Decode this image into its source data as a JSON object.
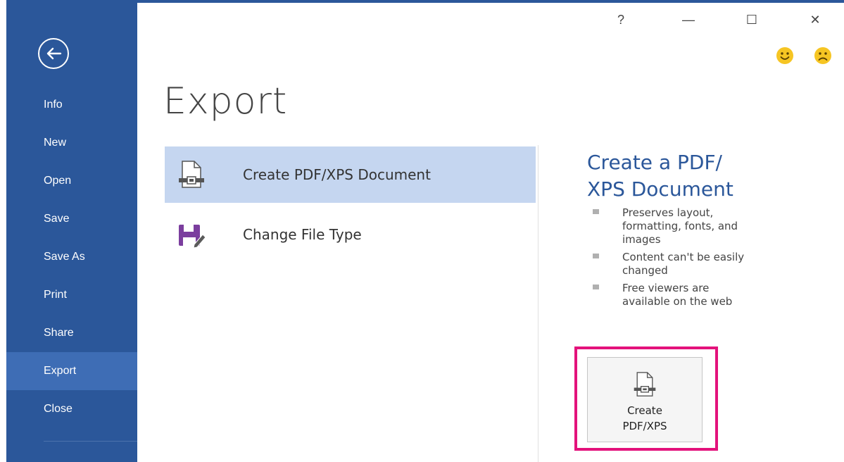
{
  "window_controls": {
    "help": "?",
    "minimize": "—",
    "maximize": "☐",
    "close": "✕"
  },
  "sidebar": {
    "back_icon": "back-arrow-icon",
    "items": [
      {
        "label": "Info",
        "active": false
      },
      {
        "label": "New",
        "active": false
      },
      {
        "label": "Open",
        "active": false
      },
      {
        "label": "Save",
        "active": false
      },
      {
        "label": "Save As",
        "active": false
      },
      {
        "label": "Print",
        "active": false
      },
      {
        "label": "Share",
        "active": false
      },
      {
        "label": "Export",
        "active": true
      },
      {
        "label": "Close",
        "active": false
      }
    ]
  },
  "feedback": {
    "smile_icon": "smile-face-icon",
    "frown_icon": "frown-face-icon"
  },
  "main": {
    "title": "Export",
    "options": [
      {
        "label": "Create PDF/XPS Document",
        "icon": "pdf-document-icon",
        "selected": true
      },
      {
        "label": "Change File Type",
        "icon": "floppy-disk-edit-icon",
        "selected": false
      }
    ]
  },
  "detail": {
    "title_line1": "Create a PDF/",
    "title_line2": "XPS Document",
    "bullets": [
      "Preserves layout, formatting, fonts, and images",
      "Content can't be easily changed",
      "Free viewers are available on the web"
    ],
    "button_line1": "Create",
    "button_line2": "PDF/XPS"
  },
  "colors": {
    "sidebar": "#2b579a",
    "sidebar_active": "#3e6db5",
    "selected_option": "#c5d6f0",
    "accent_title": "#2b579a",
    "highlight": "#e3127b",
    "change_file_icon": "#7b3e9e"
  }
}
